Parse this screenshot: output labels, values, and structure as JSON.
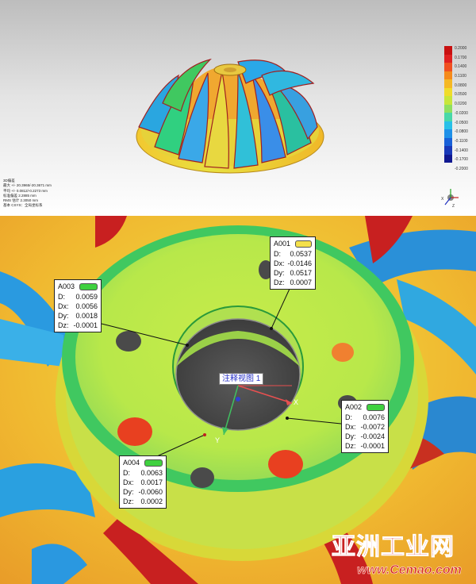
{
  "colorbar": {
    "labels": [
      "0.2000",
      "0.1700",
      "0.1400",
      "0.1100",
      "0.0800",
      "0.0500",
      "0.0200",
      "-0.0200",
      "-0.0500",
      "-0.0800",
      "-0.1100",
      "-0.1400",
      "-0.1700",
      "-0.2000"
    ],
    "colors": [
      "#c81010",
      "#e02020",
      "#f05020",
      "#f58a1a",
      "#f5b823",
      "#f0dc2a",
      "#c8e63a",
      "#8fe060",
      "#48d8a8",
      "#28c0e8",
      "#1e90e8",
      "#1860d8",
      "#1838b8",
      "#101890"
    ]
  },
  "stats": {
    "line1": "3D偏差",
    "line2": "最大 +/- 20.3965/-20.3671 mm",
    "line3": "平均 +/- 0.0812/-0.2273 mm",
    "line4": "标准偏差 2.2885 mm",
    "line5": "RMS 估计 2.3050 mm",
    "line6": "基本 CSYS：全局坐标系"
  },
  "annotations": [
    {
      "id": "A001",
      "pill_color": "#f4e04a",
      "D": "0.0537",
      "Dx": "-0.0146",
      "Dy": "0.0517",
      "Dz": "0.0007"
    },
    {
      "id": "A002",
      "pill_color": "#3fd13f",
      "D": "0.0076",
      "Dx": "-0.0072",
      "Dy": "-0.0024",
      "Dz": "-0.0001"
    },
    {
      "id": "A003",
      "pill_color": "#3fd13f",
      "D": "0.0059",
      "Dx": "0.0056",
      "Dy": "0.0018",
      "Dz": "-0.0001"
    },
    {
      "id": "A004",
      "pill_color": "#3fd13f",
      "D": "0.0063",
      "Dx": "0.0017",
      "Dy": "-0.0060",
      "Dz": "0.0002"
    }
  ],
  "labels": {
    "D": "D:",
    "Dx": "Dx:",
    "Dy": "Dy:",
    "Dz": "Dz:"
  },
  "view_label": "注释视图 1",
  "axes": {
    "x": "X",
    "y": "Y"
  },
  "watermark": {
    "title": "亚洲工业网",
    "url": "www.Cemao.com"
  }
}
